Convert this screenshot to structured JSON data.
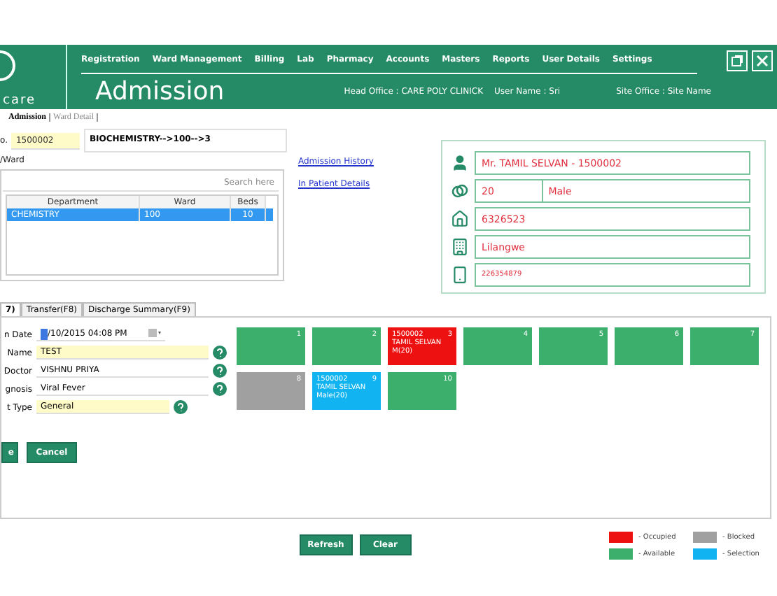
{
  "header": {
    "logo": "care",
    "nav": [
      "Registration",
      "Ward Management",
      "Billing",
      "Lab",
      "Pharmacy",
      "Accounts",
      "Masters",
      "Reports",
      "User Details",
      "Settings"
    ],
    "title": "Admission",
    "head_office": "Head Office :  CARE POLY CLINICK",
    "user_name": "User Name : Sri",
    "site_office": "Site Office : Site Name"
  },
  "page_tabs": [
    {
      "label": "Admission",
      "selected": true
    },
    {
      "label": "Ward Detail",
      "selected": false
    }
  ],
  "admission_no": {
    "label": "o.",
    "value": "1500002"
  },
  "bed_path": "BIOCHEMISTRY-->100-->3",
  "group_label": "/Ward",
  "search": {
    "placeholder": "Search here"
  },
  "table": {
    "columns": [
      "Department",
      "Ward",
      "Beds"
    ],
    "rows": [
      {
        "cells": [
          "CHEMISTRY",
          "100",
          "10"
        ],
        "selected": true
      }
    ]
  },
  "links": [
    "Admission History",
    "In Patient Details"
  ],
  "patient": {
    "name": "Mr. TAMIL SELVAN - 1500002",
    "age": "20",
    "gender": "Male",
    "phone": "6326523",
    "place": "Lilangwe",
    "mobile": "226354879"
  },
  "form_tabs": [
    {
      "label": "7)",
      "selected": true
    },
    {
      "label": "Transfer(F8)",
      "selected": false
    },
    {
      "label": "Discharge Summary(F9)",
      "selected": false
    }
  ],
  "form": [
    {
      "label": "n Date",
      "value": "/10/2015 04:08 PM",
      "kind": "date"
    },
    {
      "label": "Name",
      "value": "TEST",
      "kind": "lookup"
    },
    {
      "label": "Doctor",
      "value": "VISHNU PRIYA",
      "kind": "lookup"
    },
    {
      "label": "gnosis",
      "value": "Viral Fever",
      "kind": "lookup"
    },
    {
      "label": "t Type",
      "value": "General",
      "kind": "short"
    }
  ],
  "form_buttons": [
    "e",
    "Cancel"
  ],
  "beds": [
    [
      {
        "number": "1",
        "kind": "available"
      },
      {
        "number": "2",
        "kind": "available"
      },
      {
        "number": "3",
        "kind": "occupied",
        "id": "1500002",
        "name": "TAMIL SELVAN",
        "info": "M(20)"
      },
      {
        "number": "4",
        "kind": "available"
      },
      {
        "number": "5",
        "kind": "available"
      },
      {
        "number": "6",
        "kind": "available"
      },
      {
        "number": "7",
        "kind": "available"
      }
    ],
    [
      {
        "number": "8",
        "kind": "blocked"
      },
      {
        "number": "9",
        "kind": "selection",
        "id": "1500002",
        "name": "TAMIL SELVAN",
        "info": "Male(20)"
      },
      {
        "number": "10",
        "kind": "available"
      }
    ]
  ],
  "buttons": [
    "Refresh",
    "Clear"
  ],
  "legend": [
    {
      "label": "- Occupied",
      "color": "#ee1111"
    },
    {
      "label": "- Blocked",
      "color": "#a0a0a0"
    },
    {
      "label": "- Available",
      "color": "#3caf6c"
    },
    {
      "label": "- Selection",
      "color": "#11b4f0"
    }
  ]
}
